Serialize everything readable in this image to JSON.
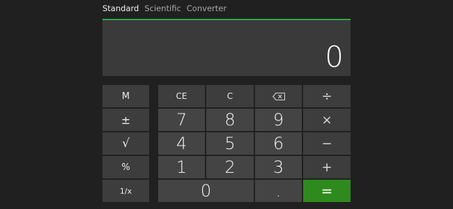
{
  "tabs": [
    {
      "label": "Standard",
      "active": true
    },
    {
      "label": "Scientific",
      "active": false
    },
    {
      "label": "Converter",
      "active": false
    }
  ],
  "display": {
    "value": "0"
  },
  "keys": {
    "memory": "M",
    "ce": "CE",
    "c": "C",
    "divide": "÷",
    "negate": "±",
    "seven": "7",
    "eight": "8",
    "nine": "9",
    "multiply": "×",
    "sqrt": "√",
    "four": "4",
    "five": "5",
    "six": "6",
    "subtract": "−",
    "percent": "%",
    "one": "1",
    "two": "2",
    "three": "3",
    "add": "+",
    "reciprocal": "1/x",
    "zero": "0",
    "decimal": ".",
    "equals": "="
  },
  "colors": {
    "accent": "#2f8a1e",
    "display_border": "#2ea84a",
    "background": "#202020"
  },
  "icons": {
    "backspace": "backspace-icon"
  }
}
